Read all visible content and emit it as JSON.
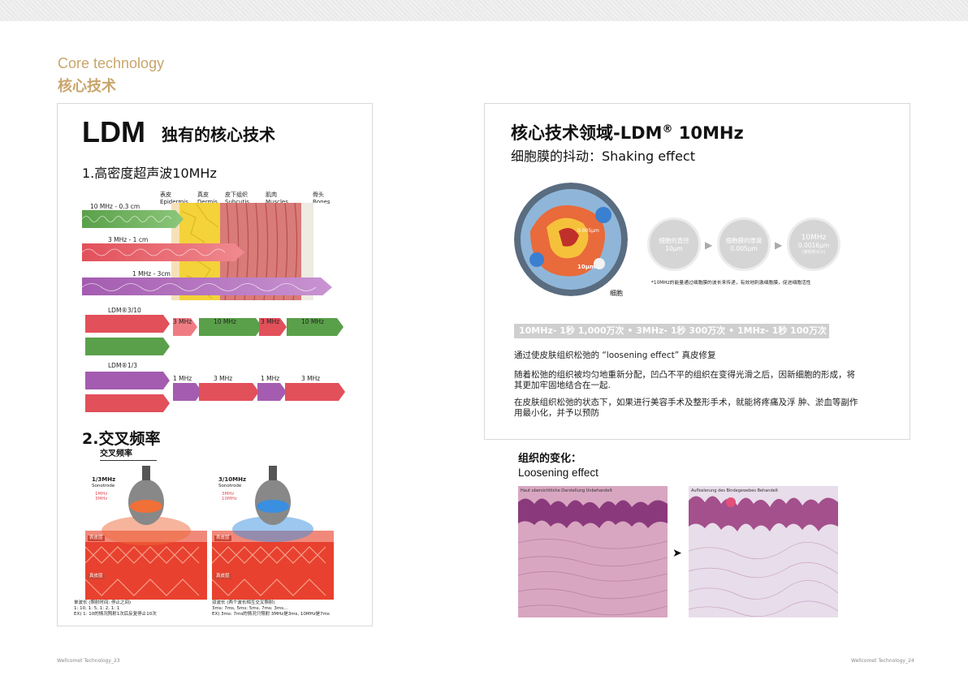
{
  "header": {
    "section_en": "Core technology",
    "section_cn": "核心技术"
  },
  "left": {
    "title": "LDM",
    "subtitle": "独有的核心技术",
    "sec1": "1.高密度超声波10MHz",
    "layers": [
      {
        "cn": "表皮",
        "en": "Epidermis"
      },
      {
        "cn": "真皮",
        "en": "Dermis"
      },
      {
        "cn": "皮下组织",
        "en": "Subcutis"
      },
      {
        "cn": "肌肉",
        "en": "Muscles"
      },
      {
        "cn": "骨头",
        "en": "Bones"
      }
    ],
    "waves": [
      "10 MHz - 0.3 cm",
      "3 MHz - 1 cm",
      "1 MHz - 3cm"
    ],
    "combo1": {
      "label": "LDM®3/10",
      "parts": [
        "3 MHz",
        "10 MHz",
        "3 MHz",
        "10 MHz"
      ]
    },
    "combo2": {
      "label": "LDM®1/3",
      "parts": [
        "1 MHz",
        "3 MHz",
        "1 MHz",
        "3 MHz"
      ]
    },
    "sec2": "2.交叉频率",
    "sec2_sub": "交叉频率",
    "cross": [
      {
        "title": "1/3MHz",
        "mode": "Sonotrode",
        "f1": "1MHz",
        "f2": "3MHz",
        "tag1": "表皮层",
        "tag2": "真皮层",
        "cap1": "单波长 (照射时间: 停止之间)",
        "cap2": "1: 10, 1: 5, 1: 2, 1: 1",
        "cap3": "EX)   1: 10的情况照射1次后反复停止10次"
      },
      {
        "title": "3/10MHz",
        "mode": "Sonotrode",
        "f1": "3MHz",
        "f2": "10MHz",
        "tag1": "表皮层",
        "tag2": "真皮层",
        "cap1": "双波长 (两个波长相互交叉照射)",
        "cap2": "3ms: 7ms, 5ms: 5ms, 7ms: 3ms...",
        "cap3": "EX)   3ms: 7ms的情况只照射 3MHz是3ms, 10MHz是7ms"
      }
    ]
  },
  "right": {
    "title_main": "核心技术领域-LDM",
    "title_sup": "®",
    "title_tail": " 10MHz",
    "subtitle": "细胞膜的抖动：Shaking effect",
    "cell_label": "细胞",
    "cell_scale": "10μm",
    "cell_scale2": "0.005μm",
    "bubbles": [
      {
        "t1": "细胞的直径",
        "t2": "10μm",
        "t3": ""
      },
      {
        "t1": "细胞膜的厚度",
        "t2": "0.005μm",
        "t3": ""
      },
      {
        "t1": "10MHz",
        "t2": "0.0016μm",
        "t3": "(波长的大小)"
      }
    ],
    "note": "*10MHz的能量通过细胞膜的波长来传递，有效地刺激细胞膜，促进细胞活性",
    "freq_bar": "10MHz- 1秒 1,000万次 • 3MHz- 1秒 300万次 • 1MHz- 1秒 100万次",
    "p1": "通过使皮肤组织松弛的 “loosening effect” 真皮修复",
    "p2": "随着松弛的组织被均匀地重新分配，凹凸不平的组织在变得光滑之后，因新细胞的形成，将其更加牢固地结合在一起.",
    "p3": "在皮肤组织松弛的状态下，如果进行美容手术及整形手术，就能将疼痛及浮 肿、淤血等副作用最小化，并予以预防"
  },
  "org": {
    "title": "组织的变化：",
    "subtitle": "Loosening effect",
    "cap_before": "Haut ubersichtliche Darstellung Unbehandelt",
    "cap_after": "Aufloslerung des Bindegewebes Behandelt",
    "arrow": "➤"
  },
  "footer": {
    "left": "Wellcomet Technology_23",
    "right": "Wellcomet Technology_24"
  },
  "colors": {
    "accent": "#c9a56b",
    "green": "#5aa04a",
    "red": "#e2505a",
    "purple": "#a45cb0",
    "gray": "#cfcfcf"
  }
}
